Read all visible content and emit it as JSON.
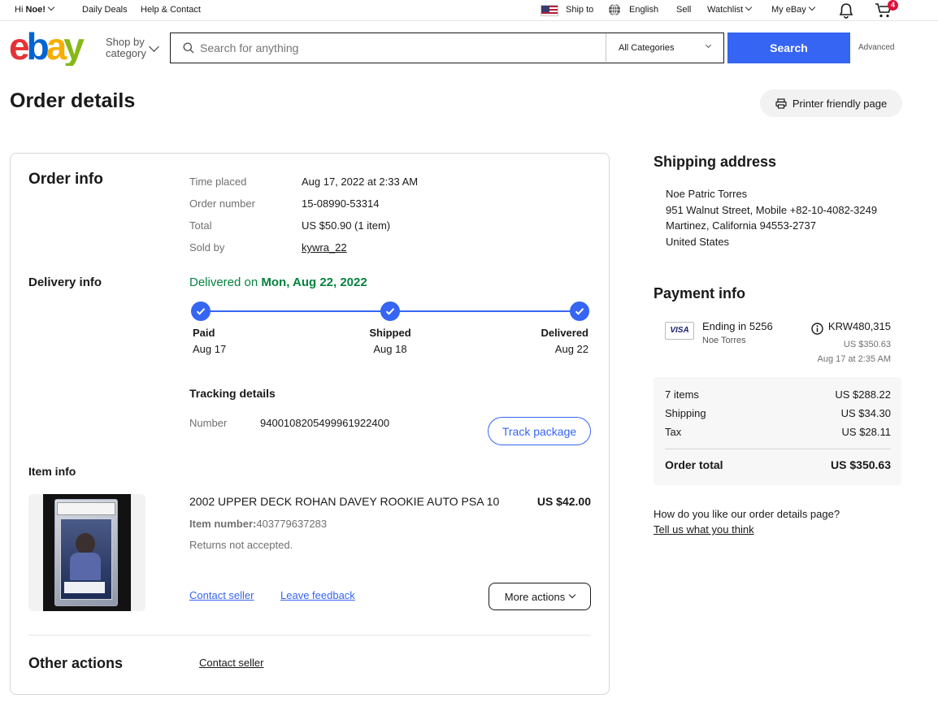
{
  "topbar": {
    "greeting_prefix": "Hi ",
    "user": "Noe!",
    "daily_deals": "Daily Deals",
    "help_contact": "Help & Contact",
    "ship_to": "Ship to",
    "language": "English",
    "sell": "Sell",
    "watchlist": "Watchlist",
    "my_ebay": "My eBay",
    "cart_count": "4"
  },
  "header": {
    "shop_by_line1": "Shop by",
    "shop_by_line2": "category",
    "search_placeholder": "Search for anything",
    "category_select": "All Categories",
    "search_button": "Search",
    "advanced": "Advanced"
  },
  "page": {
    "title": "Order details",
    "printer_button": "Printer friendly page"
  },
  "order_info": {
    "heading": "Order info",
    "rows": [
      {
        "label": "Time placed",
        "value": "Aug 17, 2022 at 2:33 AM"
      },
      {
        "label": "Order number",
        "value": "15-08990-53314"
      },
      {
        "label": "Total",
        "value": "US $50.90 (1 item)"
      },
      {
        "label": "Sold by",
        "value": "kywra_22"
      }
    ]
  },
  "delivery": {
    "heading": "Delivery info",
    "status_prefix": "Delivered on ",
    "status_date": "Mon, Aug 22, 2022",
    "steps": [
      {
        "label": "Paid",
        "date": "Aug 17"
      },
      {
        "label": "Shipped",
        "date": "Aug 18"
      },
      {
        "label": "Delivered",
        "date": "Aug 22"
      }
    ],
    "tracking_heading": "Tracking details",
    "number_label": "Number",
    "number_value": "9400108205499961922400",
    "track_button": "Track package"
  },
  "item": {
    "heading": "Item info",
    "title": "2002 UPPER DECK ROHAN DAVEY ROOKIE AUTO PSA 10",
    "price": "US $42.00",
    "item_number_label": "Item number:",
    "item_number": "403779637283",
    "returns": "Returns not accepted.",
    "contact_seller": "Contact seller",
    "leave_feedback": "Leave feedback",
    "more_actions": "More actions"
  },
  "other_actions": {
    "heading": "Other actions",
    "contact_seller": "Contact seller"
  },
  "shipping_address": {
    "heading": "Shipping address",
    "lines": [
      "Noe Patric Torres",
      "951 Walnut Street, Mobile +82-10-4082-3249",
      "Martinez, California 94553-2737",
      "United States"
    ]
  },
  "payment": {
    "heading": "Payment info",
    "card_brand": "VISA",
    "ending": "Ending in 5256",
    "holder": "Noe Torres",
    "amount_krw": "KRW480,315",
    "amount_usd": "US $350.63",
    "charged_date": "Aug 17 at 2:35 AM",
    "summary": [
      {
        "label": "7 items",
        "value": "US $288.22"
      },
      {
        "label": "Shipping",
        "value": "US $34.30"
      },
      {
        "label": "Tax",
        "value": "US $28.11"
      }
    ],
    "total_label": "Order total",
    "total_value": "US $350.63"
  },
  "feedback": {
    "question": "How do you like our order details page?",
    "link": "Tell us what you think"
  },
  "colors": {
    "brand_blue": "#3665f3",
    "delivered_green": "#05823f",
    "cart_badge": "#e0103a"
  }
}
